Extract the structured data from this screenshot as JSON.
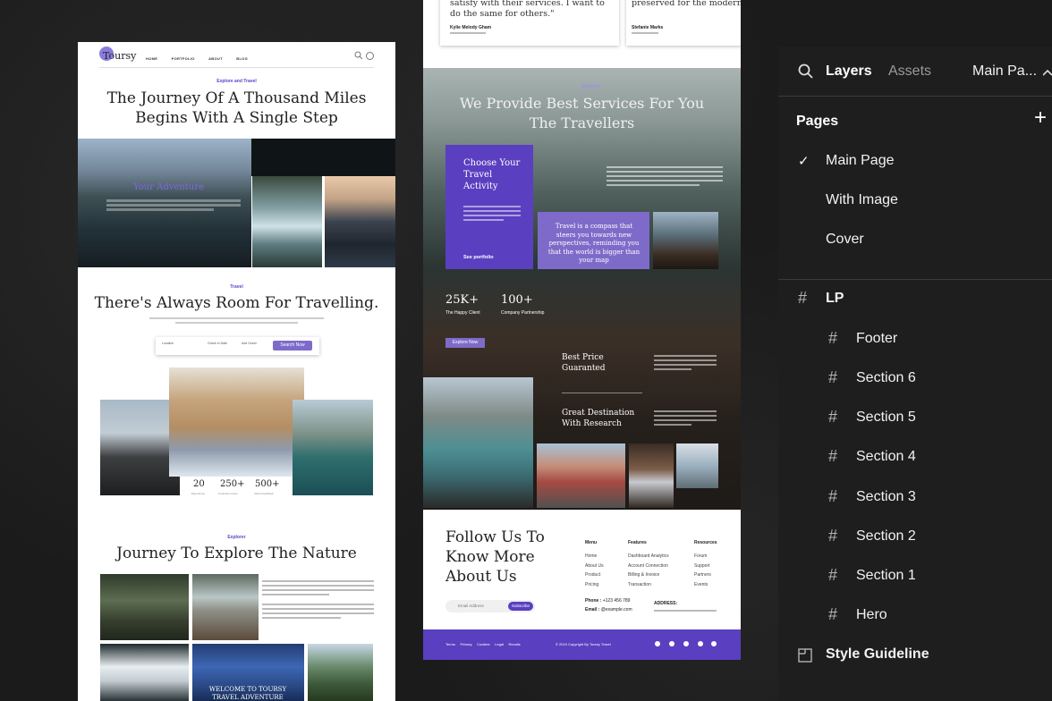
{
  "pageA": {
    "logo": "Toursy",
    "nav": [
      "HOME",
      "PORTFOLIO",
      "ABOUT",
      "BLOG"
    ],
    "hero": {
      "kicker": "Explore and Travel",
      "title_line1": "The Journey Of A Thousand Miles",
      "title_line2": "Begins With A Single Step",
      "overlay": "Your Adventure"
    },
    "travel": {
      "kicker": "Travel",
      "title": "There's Always Room For Travelling.",
      "search": {
        "location_label": "Location",
        "checkin_label": "Check in Date",
        "add_guest_label": "Add Guest",
        "button": "Search Now"
      },
      "stats": [
        {
          "value": "20",
          "label": "Experience"
        },
        {
          "value": "250+",
          "label": "Countries Cover"
        },
        {
          "value": "500+",
          "label": "Client Feedback"
        }
      ]
    },
    "explorer": {
      "kicker": "Explorer",
      "title": "Journey To Explore The Nature",
      "banner": "WELCOME TO TOURSY TRAVEL ADVENTURE"
    }
  },
  "pageB": {
    "quotes": [
      {
        "text": "satisfy with their services. I want to do the same for others.\"",
        "name": "Kylie Melody Gham"
      },
      {
        "text": "preserved for the modern \"",
        "name": "Stefanie Marks"
      }
    ],
    "services": {
      "kicker": "Services",
      "title_line1": "We Provide Best Services For You",
      "title_line2": "The Travellers",
      "card_title": "Choose Your Travel Activity",
      "card_link": "See portfolio",
      "quote": "Travel is a compass that steers you towards new perspectives, reminding you that the world is bigger than your map",
      "stats": [
        {
          "value": "25K+",
          "label": "The Happy Client"
        },
        {
          "value": "100+",
          "label": "Company Partnership"
        }
      ],
      "explore_button": "Explore Now",
      "features": [
        "Best Price Guaranted",
        "Great Destination With Research"
      ]
    },
    "footer": {
      "follow_line1": "Follow Us To",
      "follow_line2": "Know More",
      "follow_line3": "About Us",
      "email_placeholder": "Email Address",
      "subscribe": "Subscribe",
      "menu": {
        "title": "Menu",
        "items": [
          "Home",
          "About Us",
          "Product",
          "Pricing"
        ]
      },
      "features": {
        "title": "Features",
        "items": [
          "Dashboard Analytics",
          "Account Connection",
          "Billing & Invoice",
          "Transaction"
        ]
      },
      "resources": {
        "title": "Resources",
        "items": [
          "Forum",
          "Support",
          "Partners",
          "Events"
        ]
      },
      "phone_label": "Phone :",
      "phone": "+123 456 789",
      "email_label": "Email  :",
      "email": "@example.com",
      "address_label": "ADDRESS:",
      "bottom_links": [
        "Terms",
        "Privacy",
        "Cookies",
        "Legal",
        "Recalls"
      ],
      "copyright": "© 2024 Copyright By Toursy Travel"
    }
  },
  "panel": {
    "tabs": {
      "layers": "Layers",
      "assets": "Assets",
      "page_select": "Main Pa..."
    },
    "pages_title": "Pages",
    "add_icon": "+",
    "check_icon": "✓",
    "pages": [
      "Main Page",
      "With Image",
      "Cover"
    ],
    "frame_name": "LP",
    "children": [
      "Footer",
      "Section 6",
      "Section 5",
      "Section 4",
      "Section 3",
      "Section 2",
      "Section 1",
      "Hero"
    ],
    "style_guide": "Style Guideline",
    "colors": {
      "accent": "#5a3fc0",
      "panel_bg": "#1e1e1e",
      "text": "#f2f2f2",
      "muted": "#9a9a9a"
    }
  }
}
